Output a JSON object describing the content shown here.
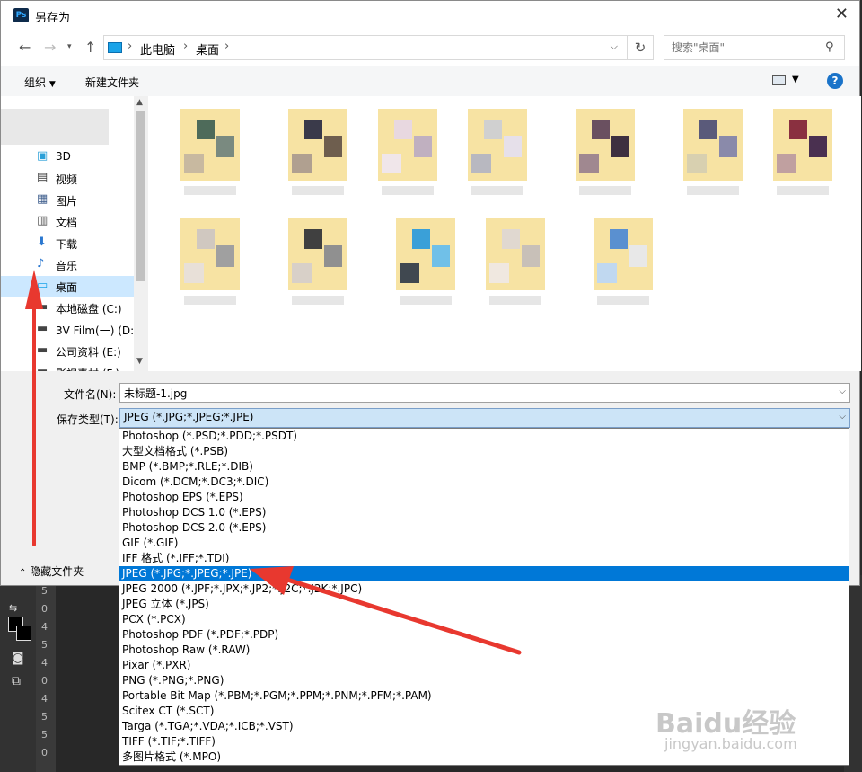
{
  "window": {
    "title": "另存为",
    "app_logo": "Ps"
  },
  "address": {
    "crumbs": [
      "此电脑",
      "桌面"
    ],
    "search_placeholder": "搜索\"桌面\""
  },
  "toolbar": {
    "organize": "组织",
    "new_folder": "新建文件夹",
    "help": "?"
  },
  "nav": {
    "items": [
      {
        "label": "3D",
        "icon": "cube-3d-icon"
      },
      {
        "label": "视频",
        "icon": "video-icon"
      },
      {
        "label": "图片",
        "icon": "pictures-icon"
      },
      {
        "label": "文档",
        "icon": "documents-icon"
      },
      {
        "label": "下载",
        "icon": "download-icon"
      },
      {
        "label": "音乐",
        "icon": "music-icon"
      },
      {
        "label": "桌面",
        "icon": "desktop-icon",
        "selected": true
      },
      {
        "label": "本地磁盘 (C:)",
        "icon": "drive-icon"
      },
      {
        "label": "3V Film(一) (D:)",
        "icon": "drive-icon"
      },
      {
        "label": "公司资料 (E:)",
        "icon": "drive-icon"
      },
      {
        "label": "影视素材 (F:)",
        "icon": "drive-icon"
      }
    ]
  },
  "form": {
    "filename_label": "文件名(N):",
    "filename_value": "未标题-1.jpg",
    "filetype_label": "保存类型(T):",
    "filetype_value": "JPEG (*.JPG;*.JPEG;*.JPE)",
    "hide_folders": "隐藏文件夹"
  },
  "filetypes": [
    "Photoshop (*.PSD;*.PDD;*.PSDT)",
    "大型文档格式 (*.PSB)",
    "BMP (*.BMP;*.RLE;*.DIB)",
    "Dicom (*.DCM;*.DC3;*.DIC)",
    "Photoshop EPS (*.EPS)",
    "Photoshop DCS 1.0 (*.EPS)",
    "Photoshop DCS 2.0 (*.EPS)",
    "GIF (*.GIF)",
    "IFF 格式 (*.IFF;*.TDI)",
    "JPEG (*.JPG;*.JPEG;*.JPE)",
    "JPEG 2000 (*.JPF;*.JPX;*.JP2;*.J2C;*.J2K;*.JPC)",
    "JPEG 立体 (*.JPS)",
    "PCX (*.PCX)",
    "Photoshop PDF (*.PDF;*.PDP)",
    "Photoshop Raw (*.RAW)",
    "Pixar (*.PXR)",
    "PNG (*.PNG;*.PNG)",
    "Portable Bit Map (*.PBM;*.PGM;*.PPM;*.PNM;*.PFM;*.PAM)",
    "Scitex CT (*.SCT)",
    "Targa (*.TGA;*.VDA;*.ICB;*.VST)",
    "TIFF (*.TIF;*.TIFF)",
    "多图片格式 (*.MPO)"
  ],
  "selected_filetype_index": 9,
  "ruler_numbers": [
    "5",
    "0",
    "4",
    "5",
    "4",
    "0",
    "4",
    "5",
    "5",
    "0"
  ],
  "watermark": {
    "text": "Baidu经验",
    "sub": "jingyan.baidu.com"
  },
  "colors": {
    "accent": "#0078d7",
    "arrow": "#e8382f",
    "selection": "#cce8ff"
  }
}
